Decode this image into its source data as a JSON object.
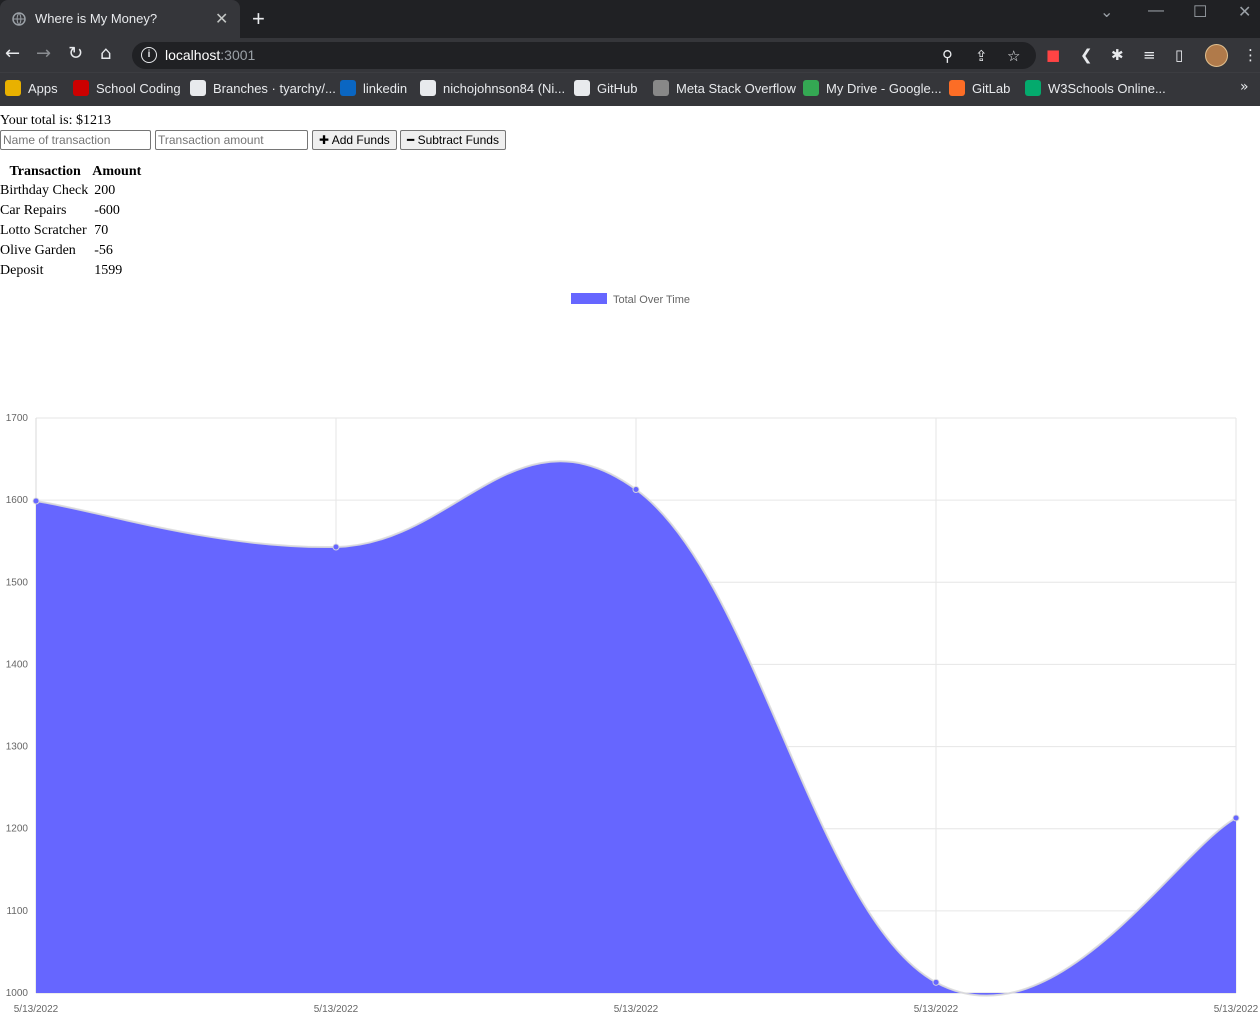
{
  "browser": {
    "tab_title": "Where is My Money?",
    "url_host": "localhost",
    "url_port": ":3001",
    "bookmarks": [
      {
        "label": "Apps",
        "icon": "apps-grid-icon",
        "color": "#e8b100"
      },
      {
        "label": "School Coding",
        "icon": "utah-u-icon",
        "color": "#cc0000"
      },
      {
        "label": "Branches · tyarchy/...",
        "icon": "github-icon",
        "color": "#e8eaed"
      },
      {
        "label": "linkedin",
        "icon": "linkedin-icon",
        "color": "#0a66c2"
      },
      {
        "label": "nichojohnson84 (Ni...",
        "icon": "github-icon",
        "color": "#e8eaed"
      },
      {
        "label": "GitHub",
        "icon": "github-icon",
        "color": "#e8eaed"
      },
      {
        "label": "Meta Stack Overflow",
        "icon": "stack-overflow-icon",
        "color": "#888888"
      },
      {
        "label": "My Drive - Google...",
        "icon": "google-drive-icon",
        "color": "#34a853"
      },
      {
        "label": "GitLab",
        "icon": "gitlab-icon",
        "color": "#fc6d26"
      },
      {
        "label": "W3Schools Online...",
        "icon": "w3schools-icon",
        "color": "#04aa6d"
      }
    ]
  },
  "app": {
    "total_text": "Your total is: $1213",
    "name_placeholder": "Name of transaction",
    "amount_placeholder": "Transaction amount",
    "add_label": "Add Funds",
    "subtract_label": "Subtract Funds",
    "table_headers": [
      "Transaction",
      "Amount"
    ],
    "transactions": [
      {
        "name": "Birthday Check",
        "amount": "200"
      },
      {
        "name": "Car Repairs",
        "amount": "-600"
      },
      {
        "name": "Lotto Scratcher",
        "amount": "70"
      },
      {
        "name": "Olive Garden",
        "amount": "-56"
      },
      {
        "name": "Deposit",
        "amount": "1599"
      }
    ]
  },
  "chart_data": {
    "type": "area",
    "legend": "Total Over Time",
    "legend_position": "top",
    "x": [
      "5/13/2022",
      "5/13/2022",
      "5/13/2022",
      "5/13/2022",
      "5/13/2022"
    ],
    "values": [
      1599,
      1543,
      1613,
      1013,
      1213
    ],
    "ylim": [
      1000,
      1700
    ],
    "yticks": [
      1000,
      1100,
      1200,
      1300,
      1400,
      1500,
      1600,
      1700
    ],
    "grid": true,
    "fill_color": "#6666ff"
  }
}
